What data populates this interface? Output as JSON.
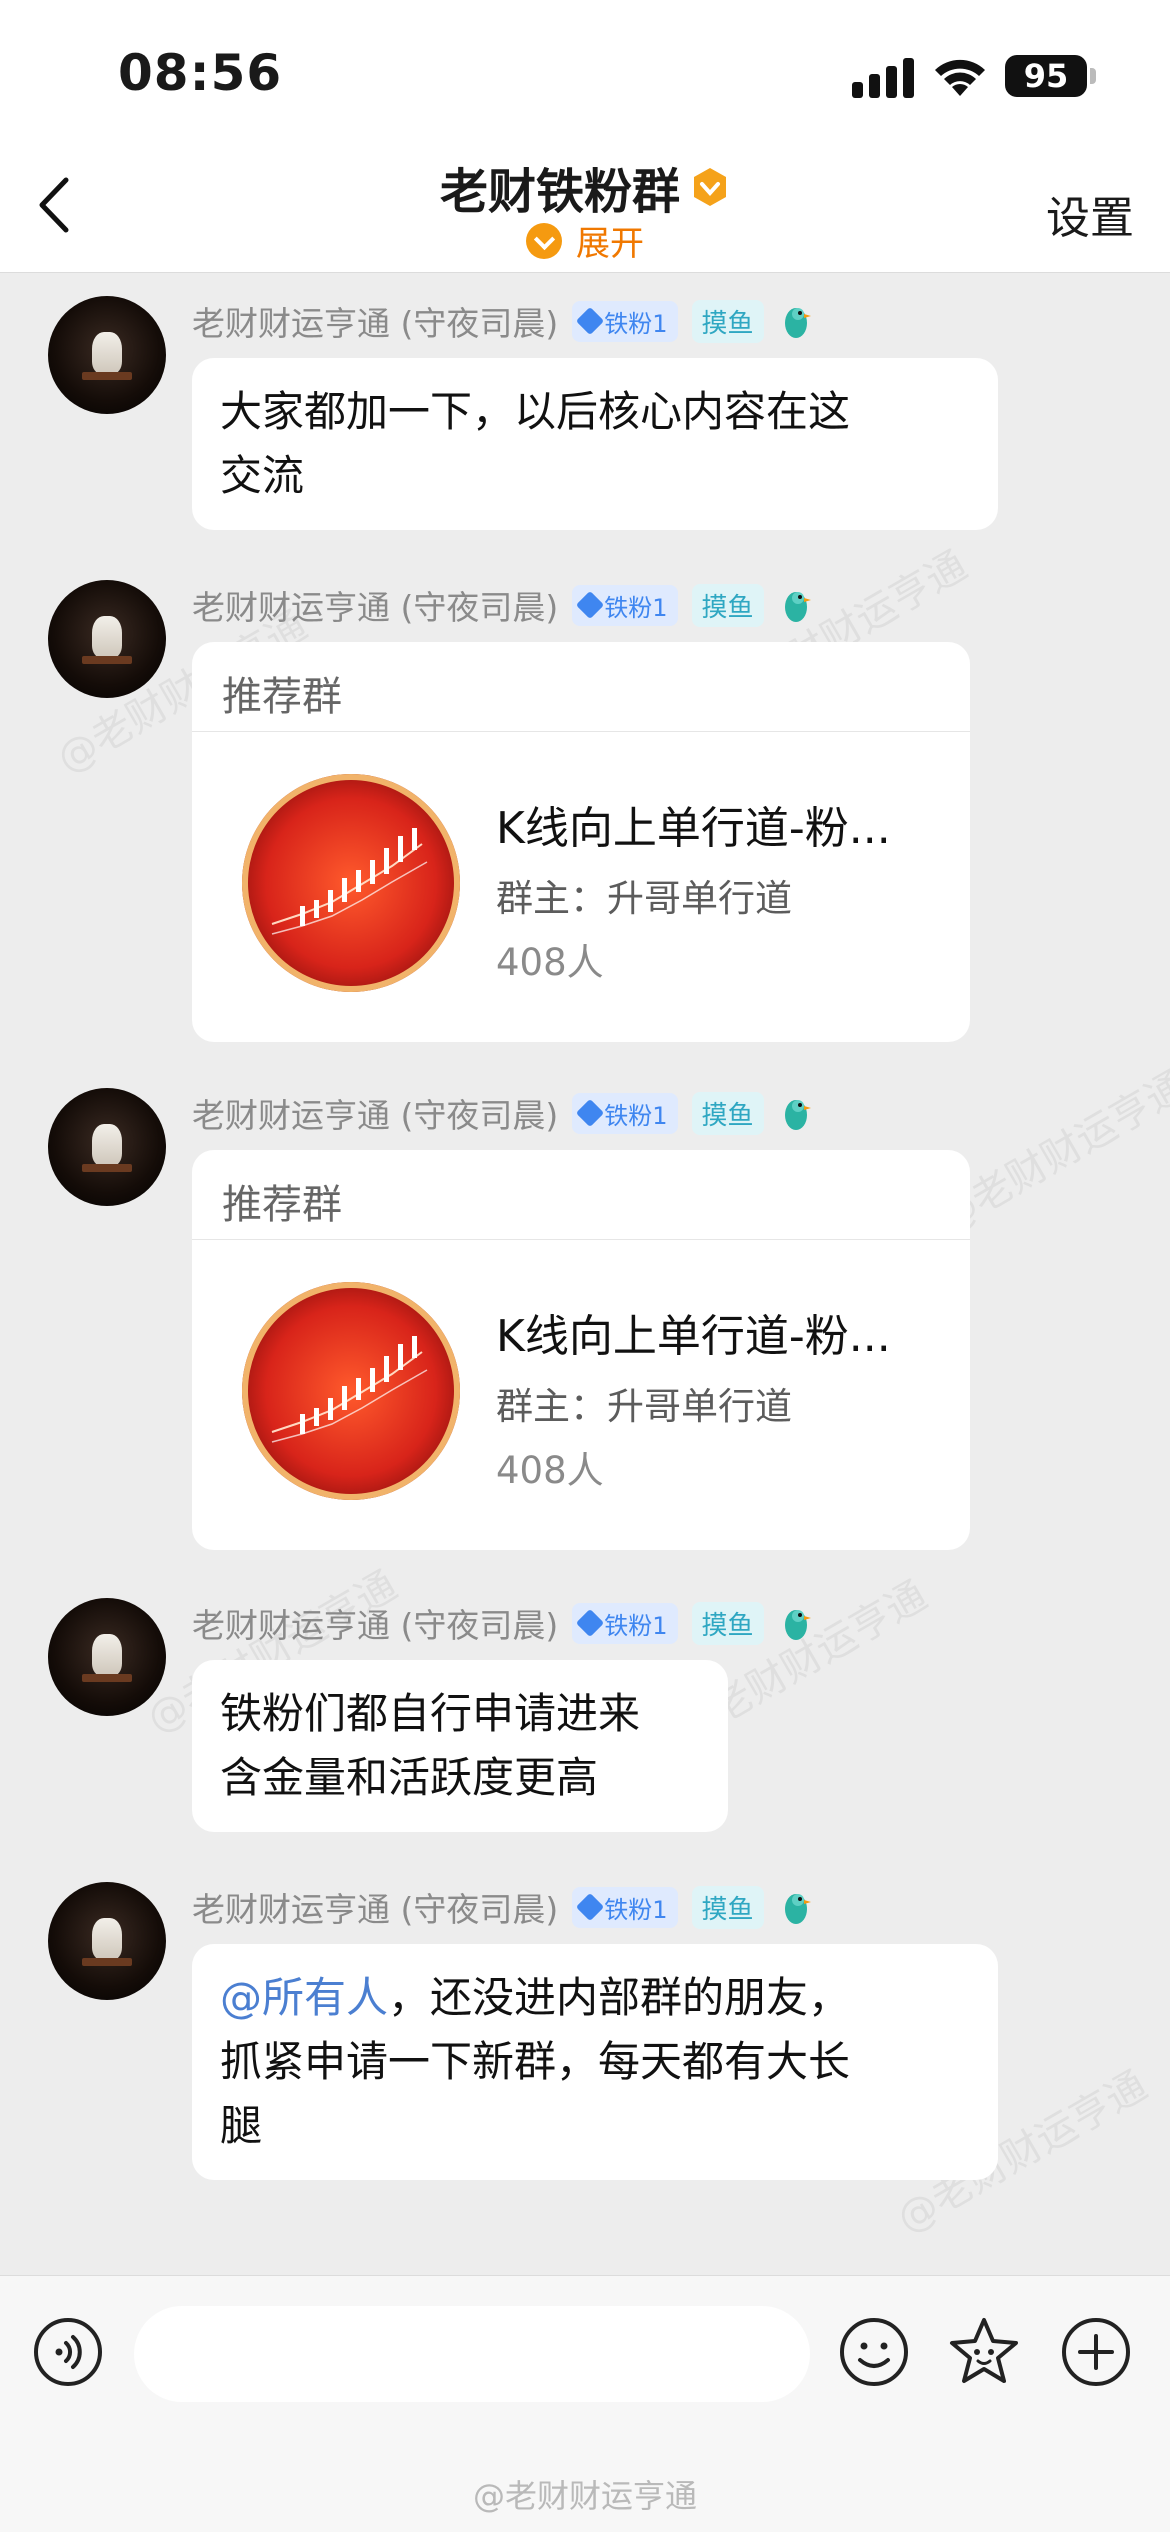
{
  "status_bar": {
    "time": "08:56",
    "battery": "95"
  },
  "nav": {
    "title": "老财铁粉群",
    "expand_label": "展开",
    "settings_label": "设置"
  },
  "messages": [
    {
      "sender": "老财财运亨通 (守夜司晨)",
      "badge_fan": "铁粉1",
      "badge_moyu": "摸鱼",
      "text_lines": [
        "大家都加一下，以后核心内容在这",
        "交流"
      ]
    },
    {
      "sender": "老财财运亨通 (守夜司晨)",
      "badge_fan": "铁粉1",
      "badge_moyu": "摸鱼",
      "card": {
        "header": "推荐群",
        "title": "K线向上单行道-粉...",
        "owner": "群主：升哥单行道",
        "count": "408人"
      }
    },
    {
      "sender": "老财财运亨通 (守夜司晨)",
      "badge_fan": "铁粉1",
      "badge_moyu": "摸鱼",
      "card": {
        "header": "推荐群",
        "title": "K线向上单行道-粉...",
        "owner": "群主：升哥单行道",
        "count": "408人"
      }
    },
    {
      "sender": "老财财运亨通 (守夜司晨)",
      "badge_fan": "铁粉1",
      "badge_moyu": "摸鱼",
      "text_lines": [
        "铁粉们都自行申请进来",
        "含金量和活跃度更高"
      ]
    },
    {
      "sender": "老财财运亨通 (守夜司晨)",
      "badge_fan": "铁粉1",
      "badge_moyu": "摸鱼",
      "mention": "@所有人",
      "text_lines": [
        "，还没进内部群的朋友，",
        "抓紧申请一下新群，每天都有大长",
        "腿"
      ]
    }
  ],
  "watermark": "@老财财运亨通",
  "footer_watermark": "@老财财运亨通",
  "colors": {
    "accent_orange": "#f07800",
    "mention_blue": "#4b7fd1",
    "fan_badge_blue": "#3f86f0"
  }
}
